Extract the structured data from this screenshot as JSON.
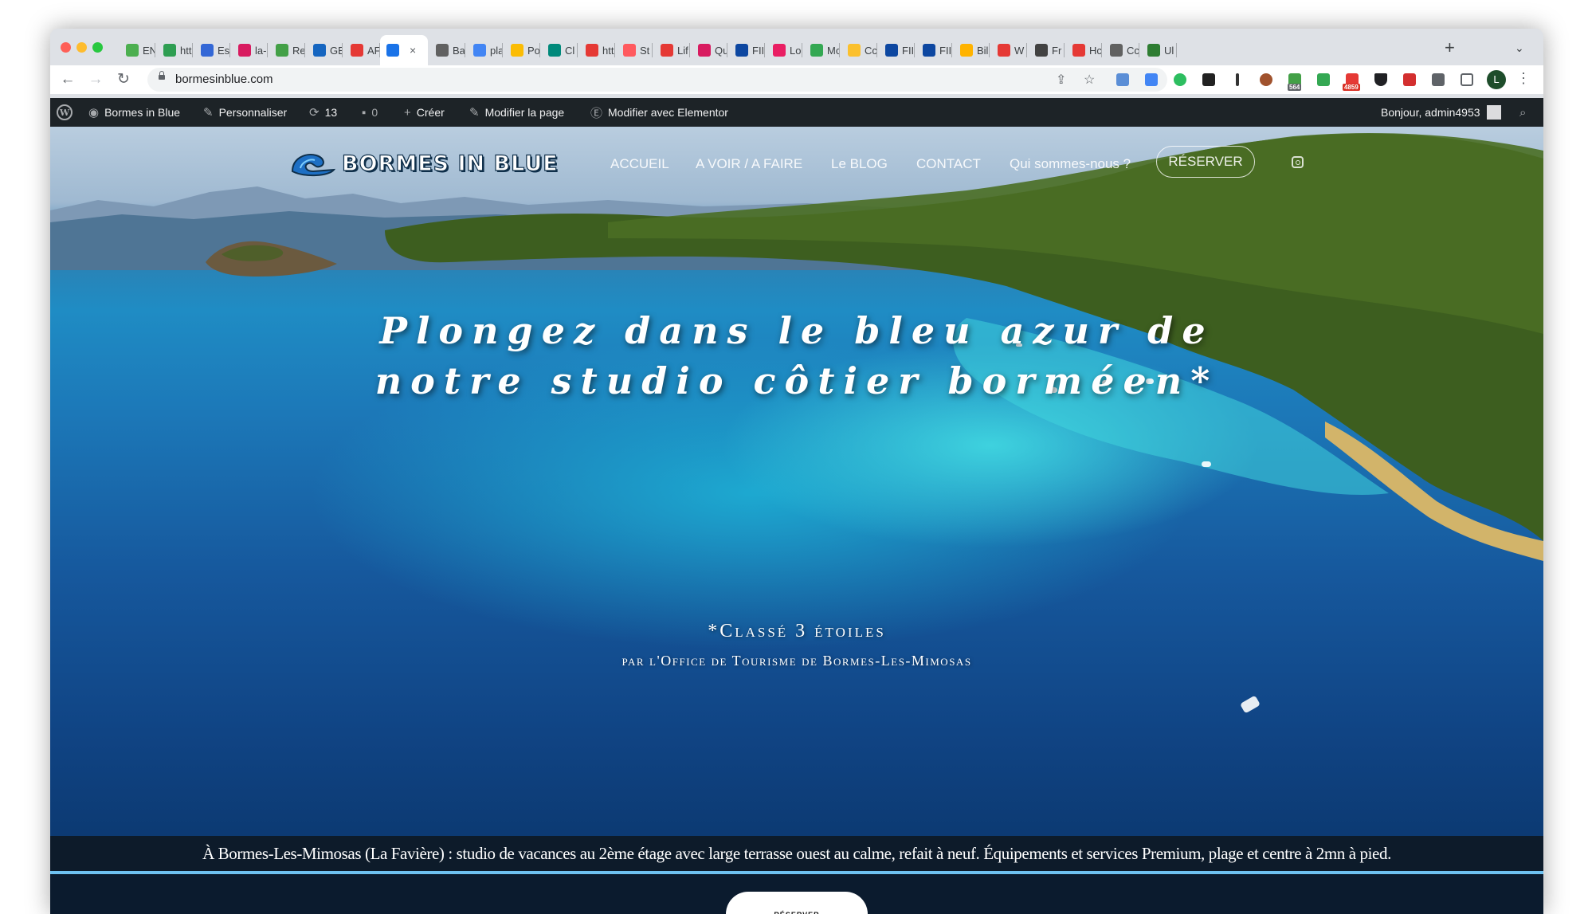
{
  "browser": {
    "tabs": [
      {
        "label": "EN",
        "color": "#4caf50"
      },
      {
        "label": "htt",
        "color": "#2e9e52"
      },
      {
        "label": "Es",
        "color": "#3367d6"
      },
      {
        "label": "la-",
        "color": "#d81b60"
      },
      {
        "label": "Re",
        "color": "#43a047"
      },
      {
        "label": "GE",
        "color": "#1565c0"
      },
      {
        "label": "AF",
        "color": "#e53935"
      },
      {
        "label": "",
        "color": "#1a73e8",
        "active": true
      },
      {
        "label": "Ba",
        "color": "#616161"
      },
      {
        "label": "pla",
        "color": "#4285f4"
      },
      {
        "label": "Po",
        "color": "#fbbc04"
      },
      {
        "label": "Cl",
        "color": "#00897b"
      },
      {
        "label": "htt",
        "color": "#e53935"
      },
      {
        "label": "St",
        "color": "#ff5a5f"
      },
      {
        "label": "Lif",
        "color": "#e53935"
      },
      {
        "label": "Qu",
        "color": "#d81b60"
      },
      {
        "label": "FII",
        "color": "#0d47a1"
      },
      {
        "label": "Lo",
        "color": "#e91e63"
      },
      {
        "label": "Mc",
        "color": "#34a853"
      },
      {
        "label": "Cc",
        "color": "#fbc02d"
      },
      {
        "label": "FII",
        "color": "#0d47a1"
      },
      {
        "label": "FII",
        "color": "#0d47a1"
      },
      {
        "label": "Bil",
        "color": "#ffb300"
      },
      {
        "label": "W",
        "color": "#e53935"
      },
      {
        "label": "Fr",
        "color": "#424242"
      },
      {
        "label": "Hc",
        "color": "#e53935"
      },
      {
        "label": "Cc",
        "color": "#616161"
      },
      {
        "label": "Ul",
        "color": "#2e7d32"
      }
    ],
    "active_tab_close": "×",
    "new_tab": "+",
    "url": "bormesinblue.com",
    "extension_badges": {
      "first": "564",
      "second": "4859"
    },
    "profile_initial": "L"
  },
  "wp_admin": {
    "site_name": "Bormes in Blue",
    "customize": "Personnaliser",
    "updates": "13",
    "comments": "0",
    "new": "Créer",
    "edit_page": "Modifier la page",
    "edit_elementor": "Modifier avec Elementor",
    "greeting": "Bonjour, admin4953"
  },
  "site": {
    "logo_text": "BORMES IN BLUE",
    "nav": [
      "ACCUEIL",
      "A VOIR / A FAIRE",
      "Le BLOG",
      "CONTACT",
      "Qui sommes-nous ?"
    ],
    "reserve_label": "RÉSERVER",
    "headline_line1": "Plongez dans le bleu azur de",
    "headline_line2": "notre studio côtier borméen*",
    "rating_line": "*Classé 3 étoiles",
    "rating_by": "par l'Office de Tourisme de Bormes-Les-Mimosas",
    "info_strip": "À Bormes-Les-Mimosas (La Favière) : studio de vacances au 2ème étage avec large terrasse ouest au calme, refait à neuf. Équipements et services Premium, plage et centre à 2mn à pied.",
    "bottom_button": "RÉSERVER"
  },
  "colors": {
    "accent_blue": "#6ec1f0",
    "wp_bar": "#1d2327",
    "footer_navy": "#0b1b2e"
  }
}
